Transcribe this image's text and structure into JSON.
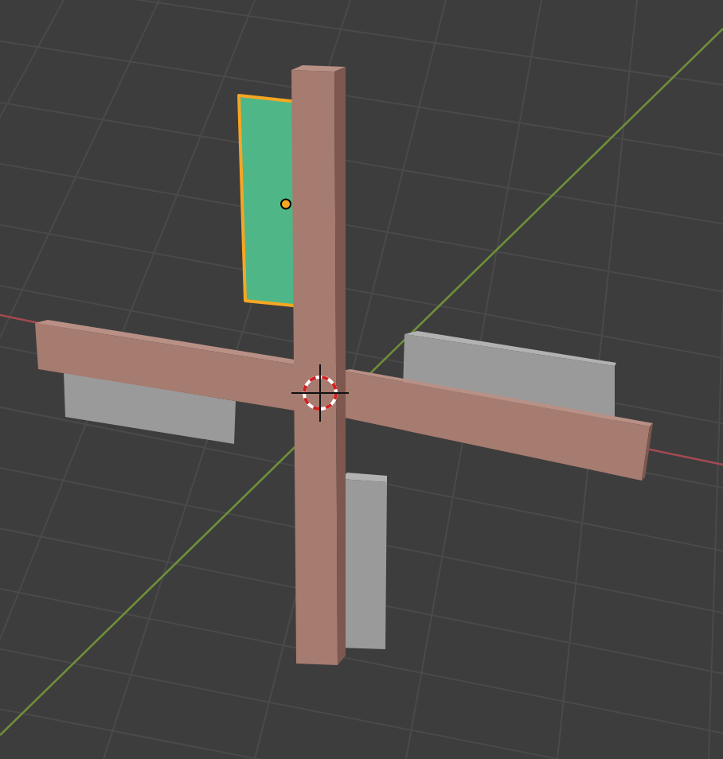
{
  "viewport": {
    "objects": [
      {
        "kind": "panel",
        "selected": false
      },
      {
        "kind": "panel",
        "selected": false
      },
      {
        "kind": "panel",
        "selected": false
      },
      {
        "kind": "beam",
        "selected": false
      },
      {
        "kind": "beam",
        "selected": false
      },
      {
        "kind": "panel",
        "selected": true
      }
    ]
  }
}
